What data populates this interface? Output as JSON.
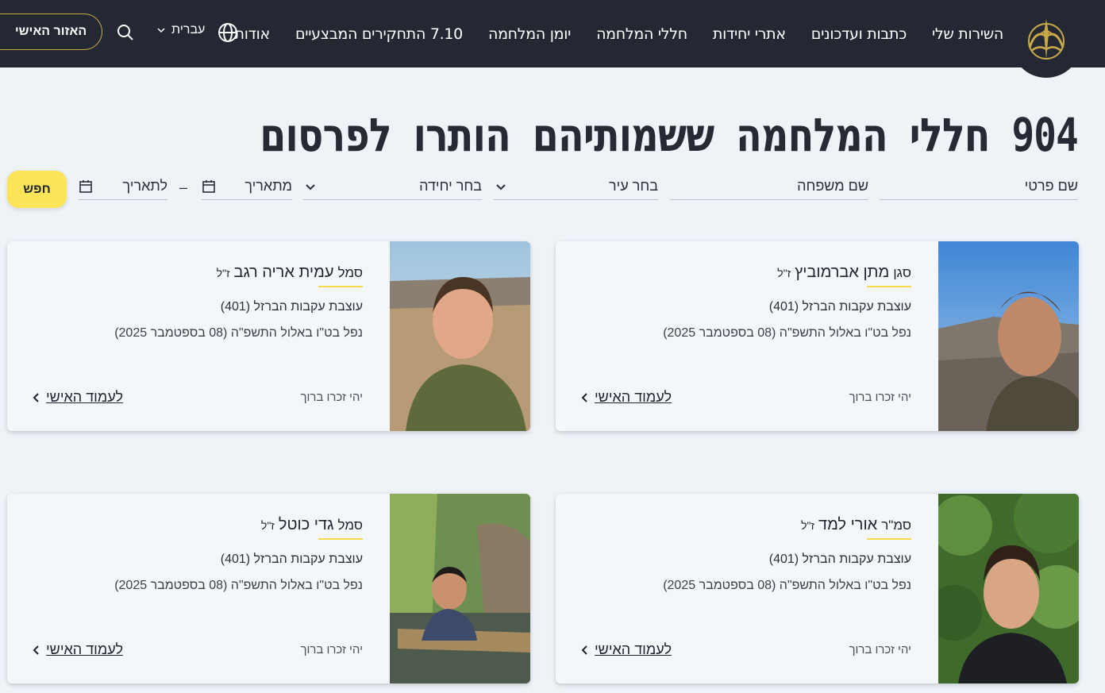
{
  "header": {
    "nav": [
      "השירות שלי",
      "כתבות ועדכונים",
      "אתרי יחידות",
      "חללי המלחמה",
      "יומן המלחמה",
      "7.10 התחקירים המבצעיים",
      "אודות"
    ],
    "language": "עברית",
    "personal_area": "האזור האישי",
    "icons": {
      "logo": "idf-emblem-icon",
      "globe": "globe-icon",
      "search": "search-icon"
    }
  },
  "title": "904 חללי המלחמה ששמותיהם הותרו לפרסום",
  "filters": {
    "first_name": "שם פרטי",
    "last_name": "שם משפחה",
    "city": "בחר עיר",
    "unit": "בחר יחידה",
    "from_date": "מתאריך",
    "to_date": "לתאריך",
    "dash": "–",
    "search": "חפש"
  },
  "cards": [
    {
      "rank": "סגן",
      "name": "מתן אברמוביץ",
      "suffix": "ז\"ל",
      "unit": "עוצבת עקבות הברזל (401)",
      "fell": "נפל בט\"ו באלול התשפ\"ה (08 בספטמבר 2025)",
      "memory": "יהי זכרו ברוך",
      "link": "לעמוד האישי"
    },
    {
      "rank": "סמל",
      "name": "עמית אריה רגב",
      "suffix": "ז\"ל",
      "unit": "עוצבת עקבות הברזל (401)",
      "fell": "נפל בט\"ו באלול התשפ\"ה (08 בספטמבר 2025)",
      "memory": "יהי זכרו ברוך",
      "link": "לעמוד האישי"
    },
    {
      "rank": "סמ\"ר",
      "name": "אורי למד",
      "suffix": "ז\"ל",
      "unit": "עוצבת עקבות הברזל (401)",
      "fell": "נפל בט\"ו באלול התשפ\"ה (08 בספטמבר 2025)",
      "memory": "יהי זכרו ברוך",
      "link": "לעמוד האישי"
    },
    {
      "rank": "סמל",
      "name": "גדי כוטל",
      "suffix": "ז\"ל",
      "unit": "עוצבת עקבות הברזל (401)",
      "fell": "נפל בט\"ו באלול התשפ\"ה (08 בספטמבר 2025)",
      "memory": "יהי זכרו ברוך",
      "link": "לעמוד האישי"
    }
  ],
  "colors": {
    "header_bg": "#232833",
    "accent_yellow": "#fde55a",
    "gold": "#c7a94a",
    "page_bg": "#eef3f8"
  }
}
